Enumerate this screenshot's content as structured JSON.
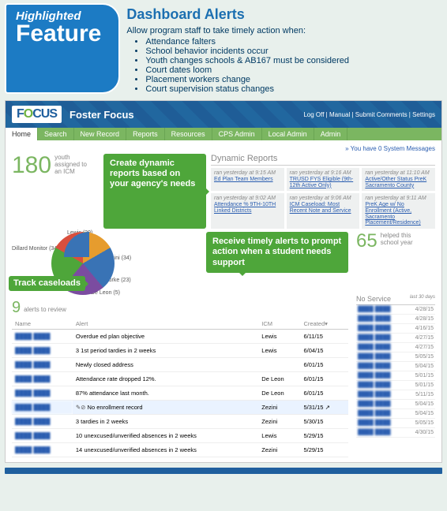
{
  "banner": {
    "highlight": "Highlighted",
    "feature": "Feature",
    "title": "Dashboard Alerts",
    "intro": "Allow program staff to take timely action when:",
    "bullets": [
      "Attendance falters",
      "School behavior incidents occur",
      "Youth changes schools & AB167 must be considered",
      "Court dates loom",
      "Placement workers change",
      "Court supervision status changes"
    ]
  },
  "app": {
    "logo_pre": "F",
    "logo_o": "O",
    "logo_post": "CUS",
    "title": "Foster Focus",
    "util": [
      "Log Off",
      "Manual",
      "Submit Comments",
      "Settings"
    ],
    "tabs": [
      "Home",
      "Search",
      "New Record",
      "Reports",
      "Resources",
      "CPS Admin",
      "Local Admin",
      "Admin"
    ]
  },
  "sysmsg": "» You have 0 System Messages",
  "youth": {
    "count": "180",
    "label1": "youth",
    "label2": "assigned to",
    "label3": "an ICM"
  },
  "callouts": {
    "reports": "Create dynamic reports based on your agency's needs",
    "caseloads": "Track caseloads",
    "alerts": "Receive timely alerts to prompt action when a student needs support"
  },
  "reports": {
    "title": "Dynamic Reports",
    "cards": [
      {
        "ts": "ran yesterday at 9:15 AM",
        "name": "Ed Plan Team Members"
      },
      {
        "ts": "ran yesterday at 9:16 AM",
        "name": "TRUSD FYS Eligible (9th-12th Active Only)"
      },
      {
        "ts": "ran yesterday at 11:10 AM",
        "name": "Active/Other Status PreK Sacramento County"
      },
      {
        "ts": "ran yesterday at 9:02 AM",
        "name": "Attendance % 9TH-10TH Linked Districts"
      },
      {
        "ts": "ran yesterday at 9:06 AM",
        "name": "ICM Caseload: Most Recent Note and Service"
      },
      {
        "ts": "ran yesterday at 9:11 AM",
        "name": "PreK Age w/ No Enrollment (Active, Sacramento Placement/Residence)"
      }
    ]
  },
  "caseload_legend": [
    {
      "name": "Lewis",
      "count": "(29)"
    },
    {
      "name": "Dillard Monitor",
      "count": "(34)"
    },
    {
      "name": "Zezini",
      "count": "(34)"
    },
    {
      "name": "Burke",
      "count": "(23)"
    },
    {
      "name": "De Leon",
      "count": "(5)"
    }
  ],
  "alerts": {
    "count": "9",
    "label": "alerts to review",
    "cols": [
      "Name",
      "Alert",
      "ICM",
      "Created▾"
    ],
    "rows": [
      {
        "alert": "Overdue ed plan objective",
        "icm": "Lewis",
        "date": "6/11/15"
      },
      {
        "alert": "3 1st period tardies in 2 weeks",
        "icm": "Lewis",
        "date": "6/04/15"
      },
      {
        "alert": "Newly closed address",
        "icm": "",
        "date": "6/01/15"
      },
      {
        "alert": "Attendance rate dropped 12%.",
        "icm": "De Leon",
        "date": "6/01/15"
      },
      {
        "alert": "87% attendance last month.",
        "icm": "De Leon",
        "date": "6/01/15"
      },
      {
        "alert": "No enrollment record",
        "icm": "Zezini",
        "date": "5/31/15",
        "hl": true,
        "icon": true
      },
      {
        "alert": "3 tardies in 2 weeks",
        "icm": "Zezini",
        "date": "5/30/15"
      },
      {
        "alert": "10 unexcused/unverified absences in 2 weeks",
        "icm": "Lewis",
        "date": "5/29/15"
      },
      {
        "alert": "14 unexcused/unverified absences in 2 weeks",
        "icm": "Zezini",
        "date": "5/29/15"
      }
    ]
  },
  "helped": {
    "count": "65",
    "label1": "helped this",
    "label2": "school year"
  },
  "service": {
    "title": "No Service",
    "col2": "last 30 days",
    "rows": [
      "4/28/15",
      "4/28/15",
      "4/16/15",
      "4/27/15",
      "4/27/15",
      "5/05/15",
      "5/04/15",
      "5/01/15",
      "5/01/15",
      "5/11/15",
      "5/04/15",
      "5/04/15",
      "5/05/15",
      "4/30/15"
    ]
  }
}
